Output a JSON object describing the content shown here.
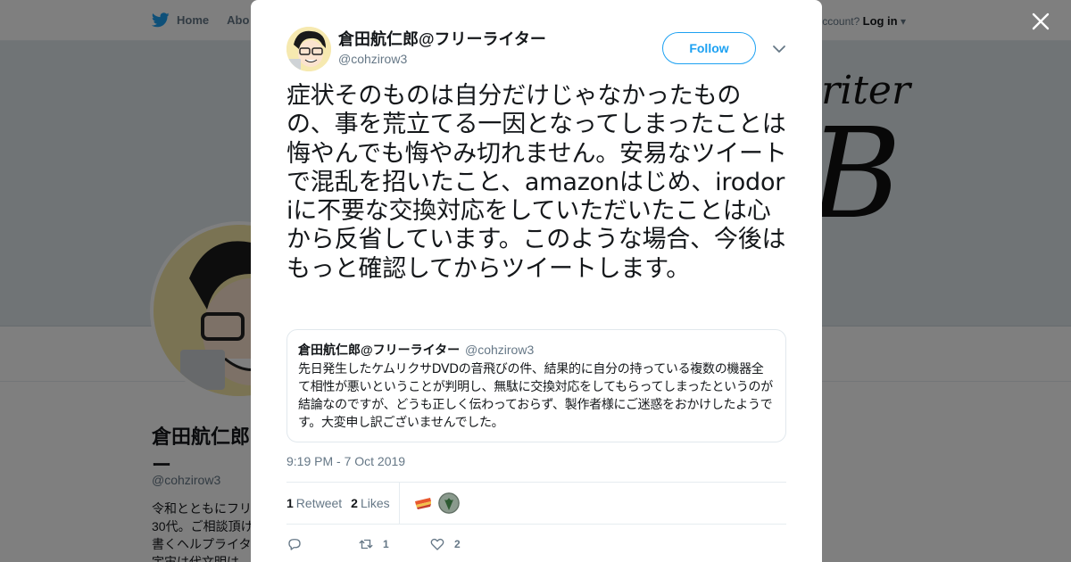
{
  "background": {
    "nav": {
      "home_label": "Home",
      "about_label": "Abo"
    },
    "login": {
      "prompt": "ccount?",
      "login_label": "Log in"
    },
    "header_text": "riter",
    "header_big": "B",
    "profile_name": "倉田航仁郎@",
    "profile_name_2": "ー",
    "profile_handle": "@cohzirow3",
    "bio_lines": [
      "令和とともにフリ",
      "30代。ご相談頂け",
      "書くヘルプライタ",
      "宇宙は代文明は-"
    ]
  },
  "tweet": {
    "display_name": "倉田航仁郎@フリーライター",
    "handle": "@cohzirow3",
    "follow_label": "Follow",
    "text": "症状そのものは自分だけじゃなかったものの、事を荒立てる一因となってしまったことは悔やんでも悔やみ切れません。安易なツイートで混乱を招いたこと、amazonはじめ、irodoriに不要な交換対応をしていただいたことは心から反省しています。このような場合、今後はもっと確認してからツイートします。",
    "quote": {
      "display_name": "倉田航仁郎@フリーライター",
      "handle": "@cohzirow3",
      "text": "先日発生したケムリクサDVDの音飛びの件、結果的に自分の持っている複数の機器全て相性が悪いということが判明し、無駄に交換対応をしてもらってしまったというのが結論なのですが、どうも正しく伝わっておらず、製作者様にご迷惑をおかけしたようです。大変申し訳ございませんでした。"
    },
    "timestamp": "9:19 PM - 7 Oct 2019",
    "stats": {
      "retweets_count": "1",
      "retweets_label": "Retweet",
      "likes_count": "2",
      "likes_label": "Likes"
    },
    "actions": {
      "reply_count": "",
      "retweet_count": "1",
      "like_count": "2"
    }
  },
  "colors": {
    "accent": "#1da1f2",
    "text": "#14171a",
    "muted": "#657786",
    "border": "#e6ecf0",
    "overlay": "rgba(0,0,0,0.5)"
  },
  "icons": [
    "twitter-bird-icon",
    "close-icon",
    "chevron-down-icon",
    "reply-icon",
    "retweet-icon",
    "heart-icon"
  ]
}
